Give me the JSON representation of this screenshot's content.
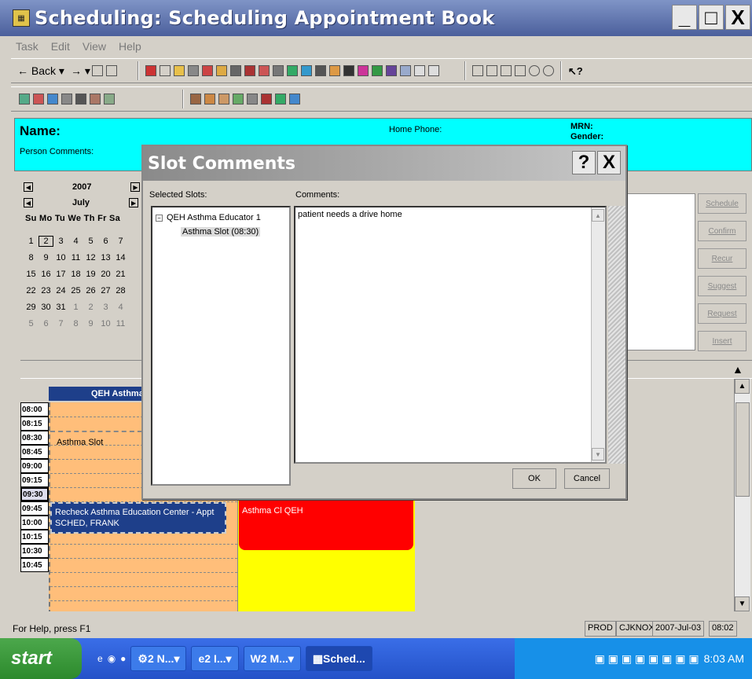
{
  "window": {
    "title": "Scheduling: Scheduling Appointment Book",
    "minimize": "_",
    "maximize": "□",
    "close": "X"
  },
  "menu": [
    "Task",
    "Edit",
    "View",
    "Help"
  ],
  "toolbar": {
    "back_label": "Back"
  },
  "banner": {
    "name_label": "Name:",
    "person_comments_label": "Person Comments:",
    "home_phone_label": "Home Phone:",
    "mrn_label": "MRN:",
    "gender_label": "Gender:"
  },
  "calendar": {
    "year": "2007",
    "month": "July",
    "day_header": "Su Mo Tu We Th Fr Sa",
    "weeks": [
      [
        "1",
        "2",
        "3",
        "4",
        "5",
        "6",
        "7"
      ],
      [
        "8",
        "9",
        "10",
        "11",
        "12",
        "13",
        "14"
      ],
      [
        "15",
        "16",
        "17",
        "18",
        "19",
        "20",
        "21"
      ],
      [
        "22",
        "23",
        "24",
        "25",
        "26",
        "27",
        "28"
      ],
      [
        "29",
        "30",
        "31",
        "1",
        "2",
        "3",
        "4"
      ],
      [
        "5",
        "6",
        "7",
        "8",
        "9",
        "10",
        "11"
      ]
    ],
    "selected": "2"
  },
  "actions": [
    "Schedule",
    "Confirm",
    "Recur",
    "Suggest",
    "Request",
    "Insert"
  ],
  "schedule": {
    "column_header": "QEH Asthma E",
    "times": [
      "08:00",
      "08:15",
      "08:30",
      "08:45",
      "09:00",
      "09:15",
      "09:30",
      "09:45",
      "10:00",
      "10:15",
      "10:30",
      "10:45"
    ],
    "slot_label": "Asthma Slot",
    "appointment_line1": "Recheck Asthma Education Center - Appt",
    "appointment_line2": "SCHED, FRANK",
    "second_column_block": "Asthma Cl QEH"
  },
  "status": {
    "help": "For Help, press F1",
    "env": "PROD",
    "user": "CJKNOX",
    "date": "2007-Jul-03",
    "time": "08:02"
  },
  "taskbar": {
    "start": "start",
    "items": [
      "2 N...",
      "2 I...",
      "2 M...",
      "Sched..."
    ],
    "clock": "8:03 AM"
  },
  "dialog": {
    "title": "Slot Comments",
    "help": "?",
    "close": "X",
    "selected_slots_label": "Selected Slots:",
    "comments_label": "Comments:",
    "tree_parent": "QEH Asthma Educator 1",
    "tree_child": "Asthma Slot  (08:30)",
    "comment_text": "patient needs a drive home",
    "ok": "OK",
    "cancel": "Cancel"
  }
}
